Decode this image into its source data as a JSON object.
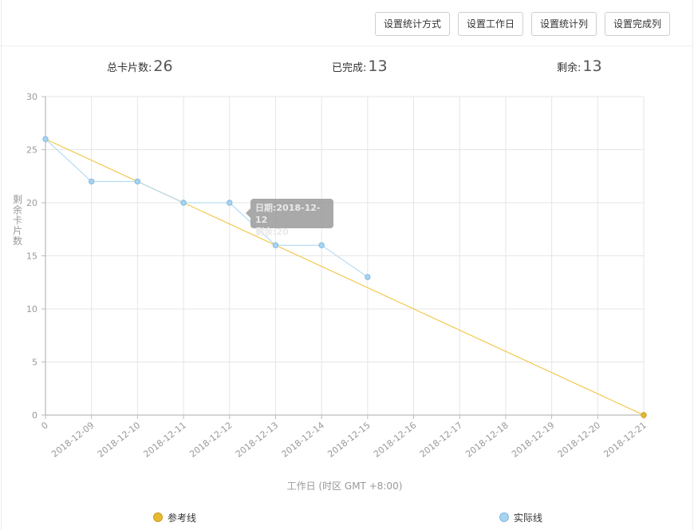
{
  "toolbar": {
    "buttons": [
      "设置统计方式",
      "设置工作日",
      "设置统计列",
      "设置完成列"
    ]
  },
  "stats": {
    "total_label": "总卡片数:",
    "total_value": "26",
    "done_label": "已完成:",
    "done_value": "13",
    "remaining_label": "剩余:",
    "remaining_value": "13"
  },
  "tooltip": {
    "line1": "日期:2018-12-12",
    "line2": "剩余:20"
  },
  "colors": {
    "reference": "#f0c030",
    "actual": "#a8d4f0",
    "actual_point": "#a8d4f0",
    "reference_point": "#e8b830"
  },
  "chart_data": {
    "type": "line",
    "categories": [
      "0",
      "2018-12-09",
      "2018-12-10",
      "2018-12-11",
      "2018-12-12",
      "2018-12-13",
      "2018-12-14",
      "2018-12-15",
      "2018-12-16",
      "2018-12-17",
      "2018-12-18",
      "2018-12-19",
      "2018-12-20",
      "2018-12-21"
    ],
    "ylabel": "剩余卡片数",
    "xlabel": "工作日 (时区 GMT +8:00)",
    "ylim": [
      0,
      30
    ],
    "yticks": [
      0,
      5,
      10,
      15,
      20,
      25,
      30
    ],
    "grid": true,
    "legend_position": "bottom",
    "series": [
      {
        "name": "参考线",
        "values": [
          26,
          null,
          null,
          null,
          null,
          null,
          null,
          null,
          null,
          null,
          null,
          null,
          null,
          0
        ]
      },
      {
        "name": "实际线",
        "values": [
          26,
          22,
          22,
          20,
          20,
          16,
          16,
          13,
          null,
          null,
          null,
          null,
          null,
          null
        ]
      }
    ]
  }
}
